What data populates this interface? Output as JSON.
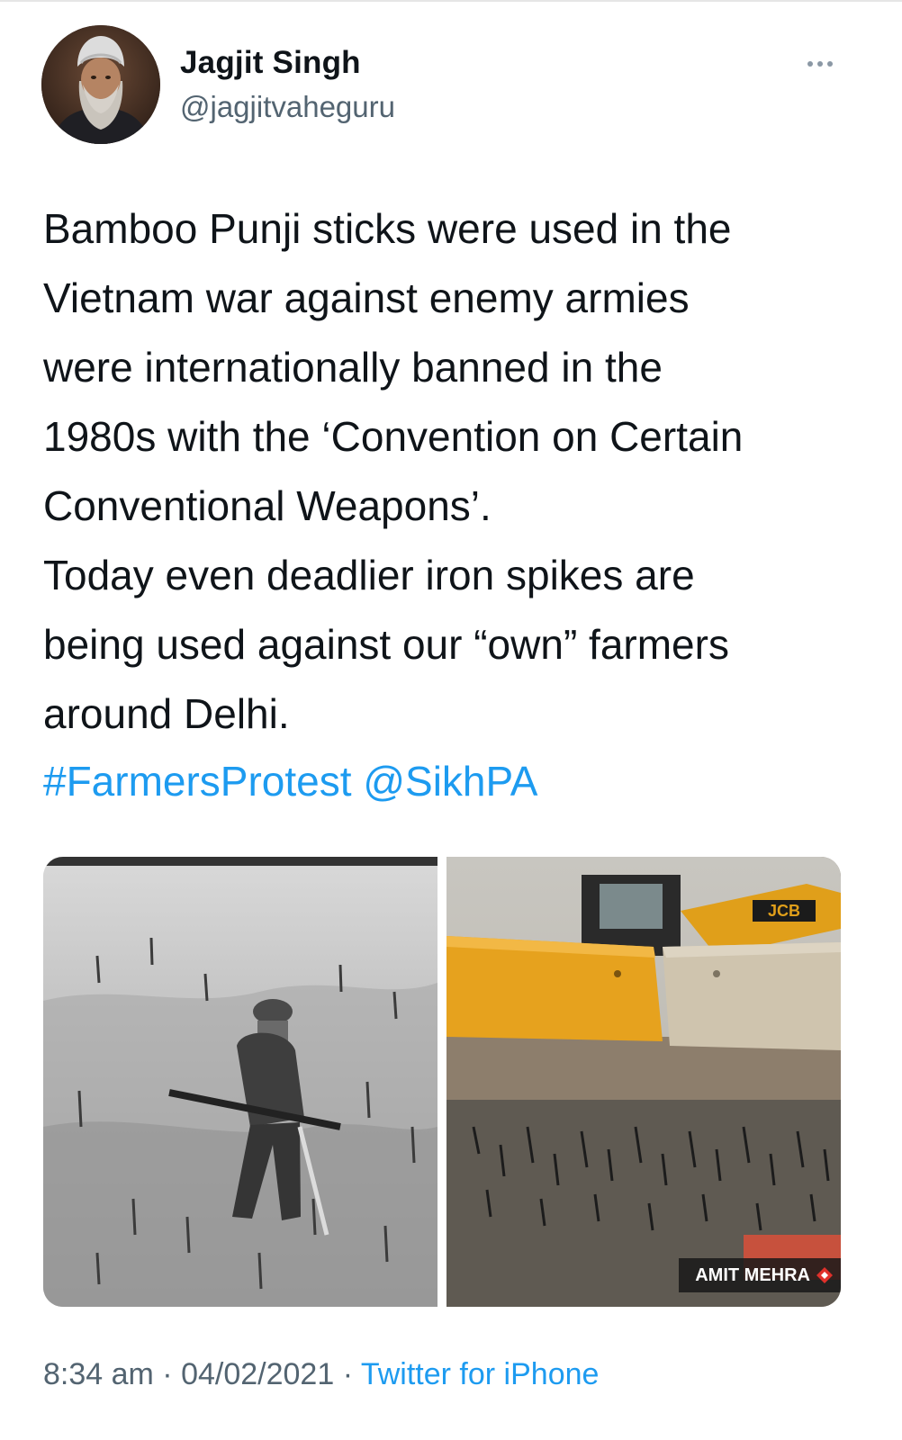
{
  "tweet": {
    "author": {
      "display_name": "Jagjit Singh",
      "handle": "@jagjitvaheguru"
    },
    "text_lines": [
      "Bamboo Punji sticks were used in the",
      "Vietnam war against enemy armies",
      "were internationally banned in the",
      "1980s with the ‘Convention on Certain",
      "Conventional Weapons’.",
      "Today even deadlier iron spikes are",
      "being used against our “own” farmers",
      "around Delhi."
    ],
    "hashtag": "#FarmersProtest",
    "mention": "@SikhPA",
    "media": {
      "right_image_credit": "AMIT MEHRA",
      "banner_text": "JCB"
    },
    "meta": {
      "time": "8:34 am",
      "separator": " · ",
      "date": "04/02/2021",
      "source": "Twitter for iPhone"
    }
  },
  "colors": {
    "link": "#1d9bf0",
    "secondary_text": "#536471",
    "primary_text": "#0f1419"
  },
  "icons": {
    "more": "more-horizontal-icon",
    "credit_logo": "red-diamond-logo-icon"
  }
}
